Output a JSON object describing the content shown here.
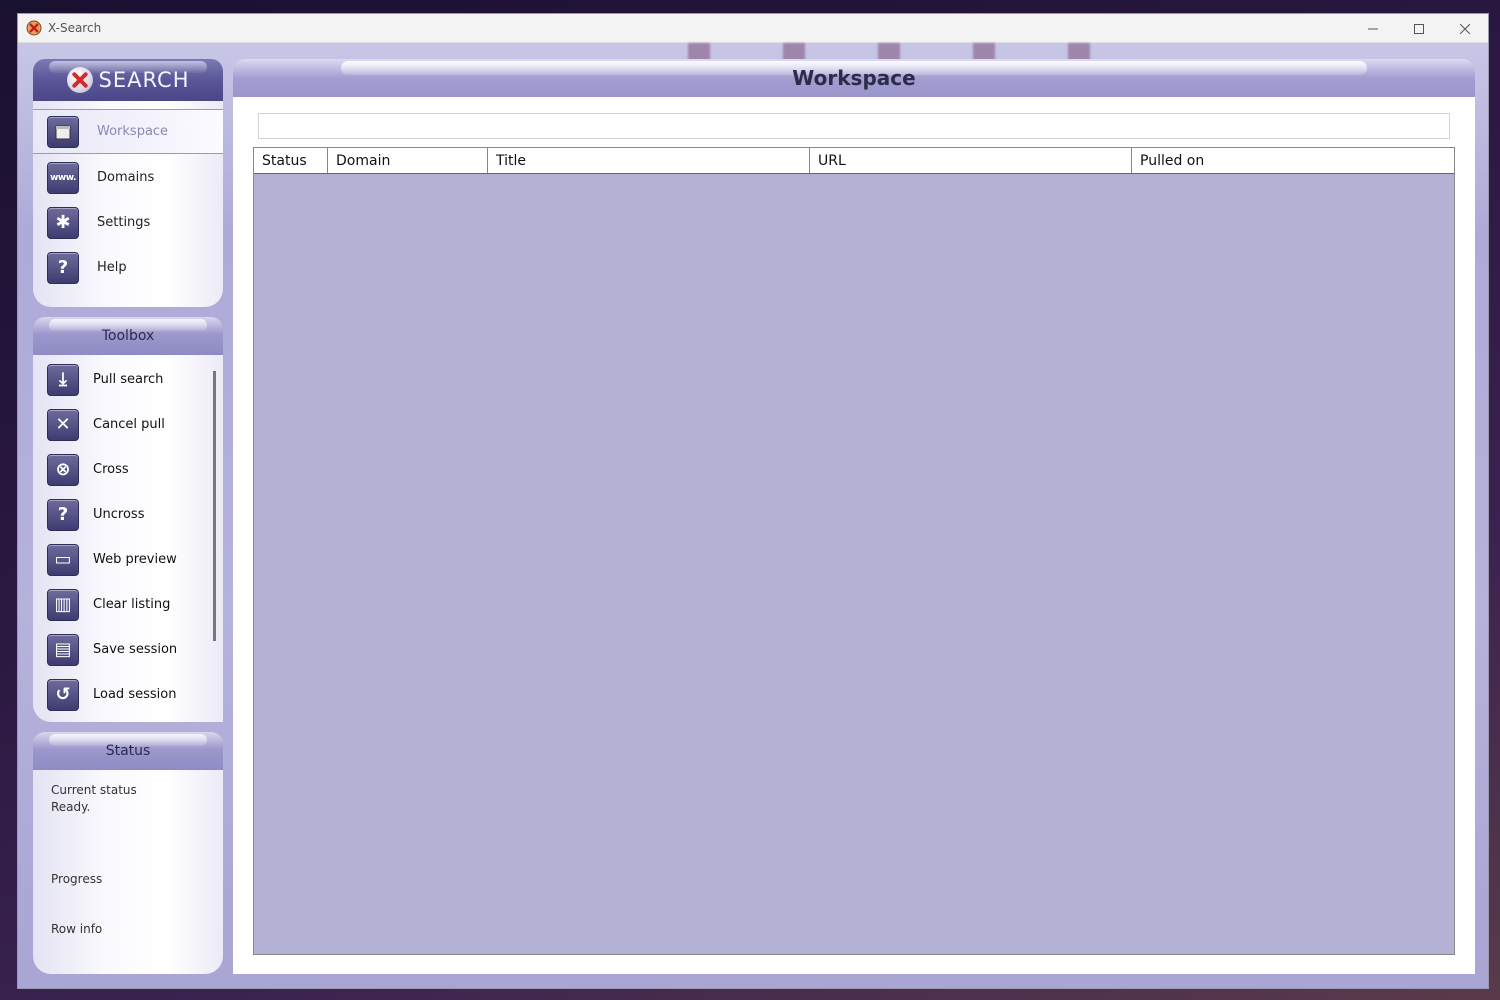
{
  "window": {
    "title": "X-Search"
  },
  "logo": {
    "text": "SEARCH"
  },
  "nav": {
    "items": [
      {
        "label": "Workspace",
        "icon": "calendar-icon",
        "active": true
      },
      {
        "label": "Domains",
        "icon": "www-icon",
        "glyph": "www."
      },
      {
        "label": "Settings",
        "icon": "gear-icon",
        "glyph": "✱"
      },
      {
        "label": "Help",
        "icon": "question-icon",
        "glyph": "?"
      }
    ]
  },
  "toolbox": {
    "title": "Toolbox",
    "items": [
      {
        "label": "Pull search",
        "icon": "download-icon",
        "glyph": "⤓"
      },
      {
        "label": "Cancel pull",
        "icon": "cancel-download-icon",
        "glyph": "✕"
      },
      {
        "label": "Cross",
        "icon": "cross-circle-icon",
        "glyph": "⊗"
      },
      {
        "label": "Uncross",
        "icon": "question-circle-icon",
        "glyph": "?"
      },
      {
        "label": "Web preview",
        "icon": "web-window-icon",
        "glyph": "▭"
      },
      {
        "label": "Clear listing",
        "icon": "trash-icon",
        "glyph": "▥"
      },
      {
        "label": "Save session",
        "icon": "save-session-icon",
        "glyph": "▤"
      },
      {
        "label": "Load session",
        "icon": "load-session-icon",
        "glyph": "↺"
      }
    ]
  },
  "status": {
    "title": "Status",
    "current_label": "Current status",
    "current_value": "Ready.",
    "progress_label": "Progress",
    "row_info_label": "Row info"
  },
  "workspace": {
    "title": "Workspace",
    "search_value": "",
    "columns": [
      "Status",
      "Domain",
      "Title",
      "URL",
      "Pulled on"
    ]
  }
}
